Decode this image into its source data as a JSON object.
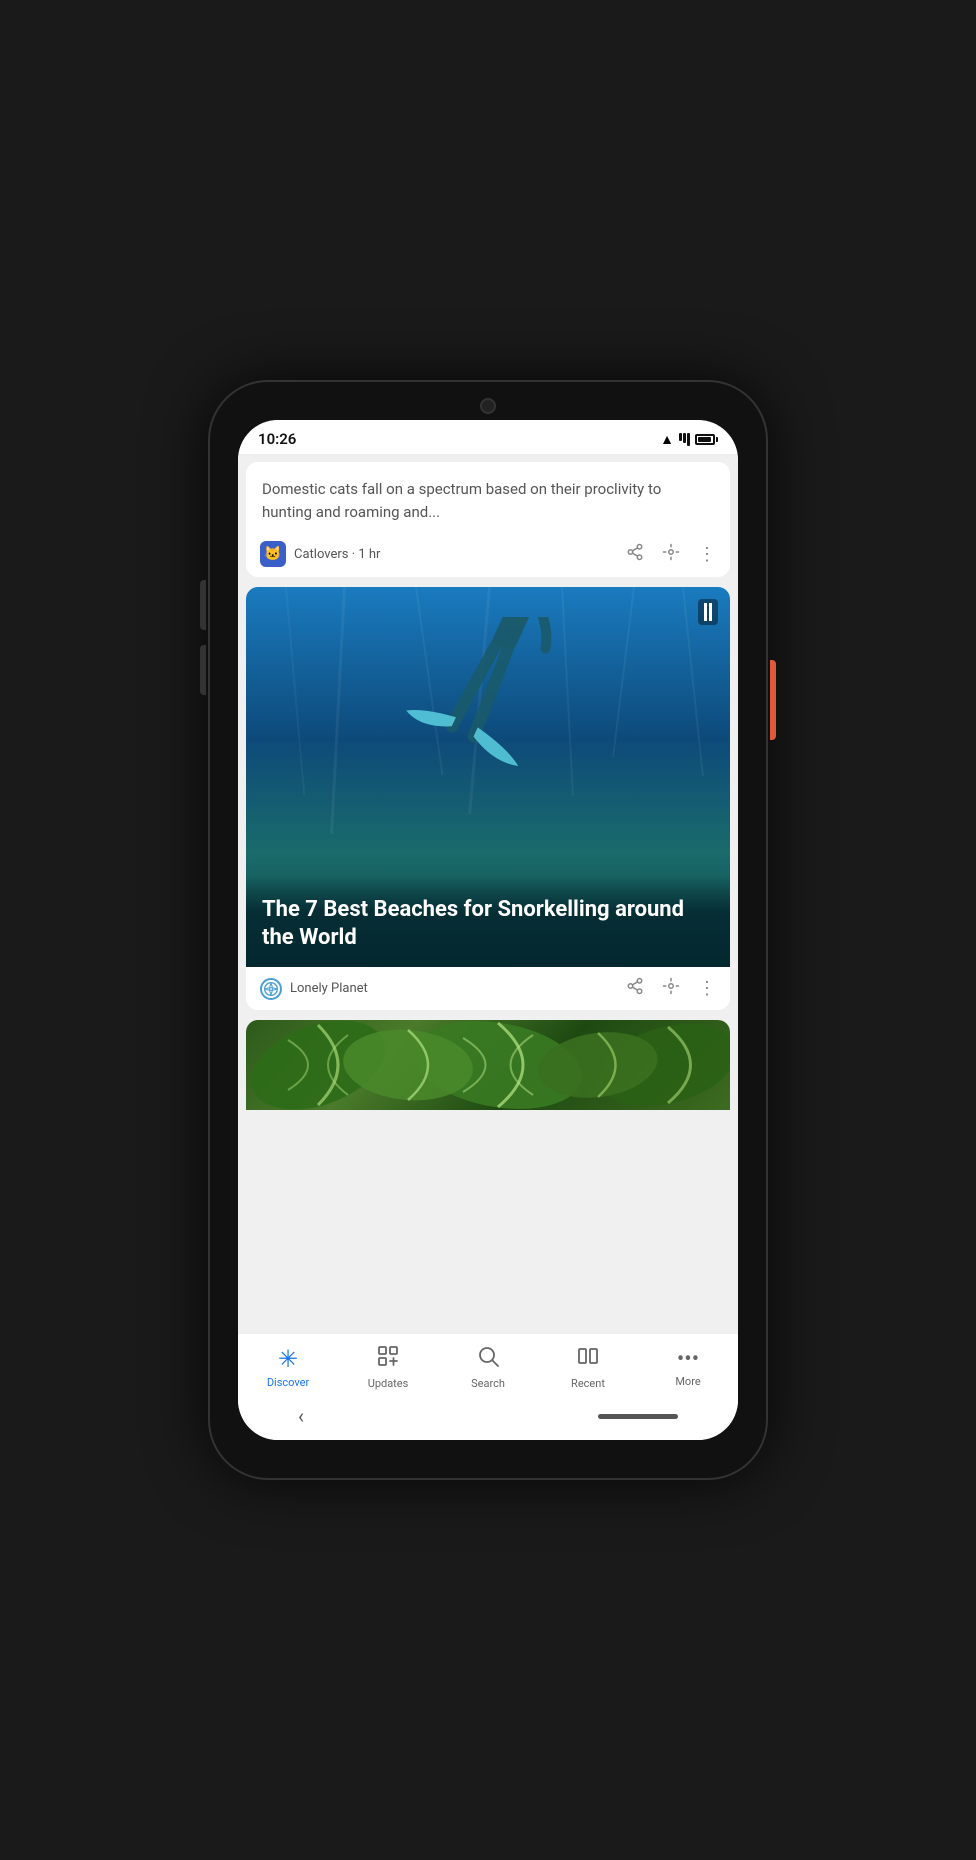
{
  "status_bar": {
    "time": "10:26"
  },
  "cards": [
    {
      "id": "cat-article",
      "body_text": "Domestic cats fall on a spectrum based on their proclivity to hunting and roaming and...",
      "source_name": "Catlovers · 1 hr",
      "source_icon_type": "cat"
    },
    {
      "id": "snorkeling-article",
      "title": "The 7 Best Beaches for Snorkelling around the World",
      "source_name": "Lonely Planet",
      "source_icon_type": "lp"
    },
    {
      "id": "plant-article",
      "partial": true
    }
  ],
  "bottom_nav": {
    "items": [
      {
        "id": "discover",
        "label": "Discover",
        "active": true,
        "icon": "discover"
      },
      {
        "id": "updates",
        "label": "Updates",
        "active": false,
        "icon": "updates"
      },
      {
        "id": "search",
        "label": "Search",
        "active": false,
        "icon": "search"
      },
      {
        "id": "recent",
        "label": "Recent",
        "active": false,
        "icon": "recent"
      },
      {
        "id": "more",
        "label": "More",
        "active": false,
        "icon": "more"
      }
    ]
  },
  "actions": {
    "share_label": "share",
    "pin_label": "pin",
    "more_label": "more"
  }
}
